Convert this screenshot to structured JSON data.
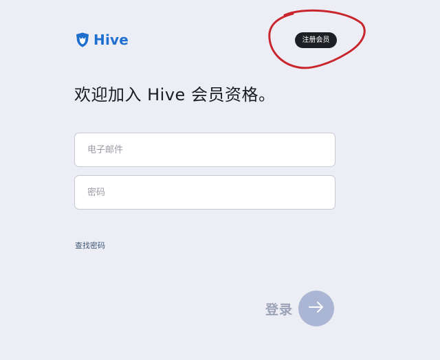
{
  "brand": {
    "name": "Hive",
    "logo_icon": "hive-shield-icon",
    "color": "#1f6fd1"
  },
  "header": {
    "signup_label": "注册会员"
  },
  "main": {
    "headline": "欢迎加入 Hive 会员资格。",
    "email_placeholder": "电子邮件",
    "email_value": "",
    "password_placeholder": "密码",
    "password_value": "",
    "forgot_password_label": "查找密码",
    "login_label": "登录",
    "login_icon": "arrow-right-icon"
  },
  "colors": {
    "background": "#ededf5",
    "annotation": "#c8262c",
    "login_button": "#aab6d4"
  }
}
